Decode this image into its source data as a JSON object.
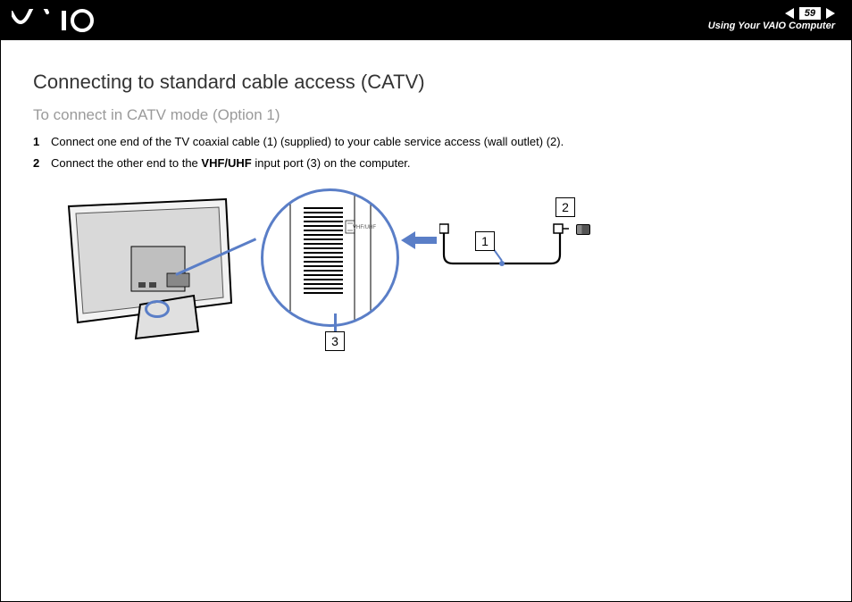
{
  "header": {
    "page_number": "59",
    "section_title": "Using Your VAIO Computer"
  },
  "content": {
    "title": "Connecting to standard cable access (CATV)",
    "subtitle": "To connect in CATV mode (Option 1)",
    "steps": {
      "s1_a": "Connect one end of the TV coaxial cable (1) (supplied) to your cable service access (wall outlet) (2).",
      "s2_a": "Connect the other end to the ",
      "s2_bold": "VHF/UHF",
      "s2_b": " input port (3) on the computer."
    }
  },
  "diagram": {
    "callout_1": "1",
    "callout_2": "2",
    "callout_3": "3",
    "port_label": "VHF/UHF"
  }
}
